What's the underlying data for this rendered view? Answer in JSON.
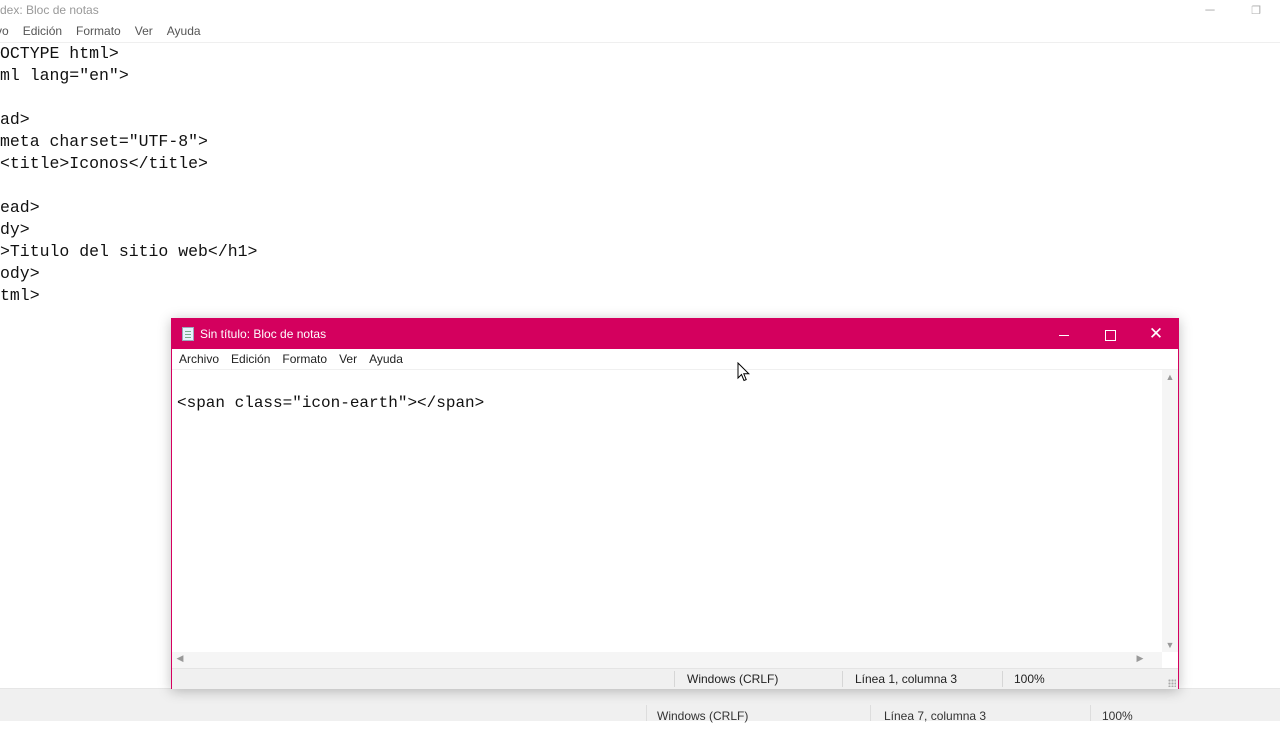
{
  "background_window": {
    "title": "dex: Bloc de notas",
    "menu": [
      "vo",
      "Edición",
      "Formato",
      "Ver",
      "Ayuda"
    ],
    "lines": [
      "OCTYPE html>",
      "ml lang=\"en\">",
      "",
      "ad>",
      "meta charset=\"UTF-8\">",
      "<title>Iconos</title>",
      "",
      "ead>",
      "dy>",
      ">Titulo del sitio web</h1>",
      "ody>",
      "tml>"
    ],
    "status": {
      "line_ending": "Windows (CRLF)",
      "position": "Línea 7, columna 3",
      "zoom": "100%"
    }
  },
  "foreground_window": {
    "title": "Sin título: Bloc de notas",
    "menu": [
      "Archivo",
      "Edición",
      "Formato",
      "Ver",
      "Ayuda"
    ],
    "content_line": "<span class=\"icon-earth\"></span>",
    "status": {
      "line_ending": "Windows (CRLF)",
      "position": "Línea 1, columna 3",
      "zoom": "100%"
    },
    "accent_color": "#d4005e"
  }
}
